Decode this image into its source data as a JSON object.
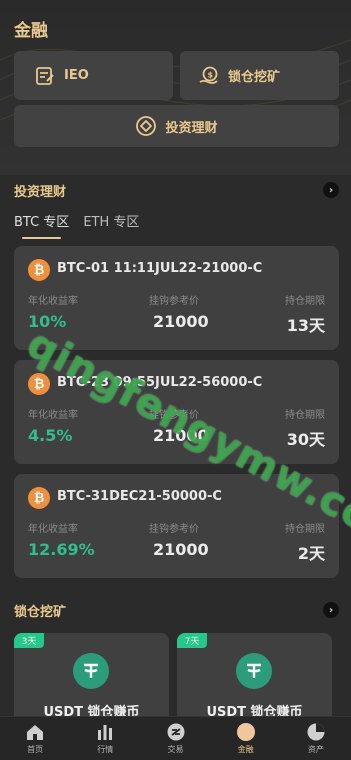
{
  "page_title": "金融",
  "tiles": {
    "ieo": "IEO",
    "mining": "锁仓挖矿",
    "invest": "投资理财"
  },
  "invest_section": {
    "title": "投资理财",
    "tabs": [
      "BTC 专区",
      "ETH 专区"
    ]
  },
  "products": [
    {
      "name": "BTC-01 11:11JUL22-21000-C",
      "rate_label": "年化收益率",
      "rate": "10%",
      "price_label": "挂钩参考价",
      "price": "21000",
      "term_label": "持仓期限",
      "term": "13天"
    },
    {
      "name": "BTC-23 09:55JUL22-56000-C",
      "rate_label": "年化收益率",
      "rate": "4.5%",
      "price_label": "挂钩参考价",
      "price": "21000",
      "term_label": "持仓期限",
      "term": "30天"
    },
    {
      "name": "BTC-31DEC21-50000-C",
      "rate_label": "年化收益率",
      "rate": "12.69%",
      "price_label": "挂钩参考价",
      "price": "21000",
      "term_label": "持仓期限",
      "term": "2天"
    }
  ],
  "mining_section": {
    "title": "锁仓挖矿",
    "items": [
      {
        "badge": "3天",
        "title": "USDT 锁仓赚币"
      },
      {
        "badge": "7天",
        "title": "USDT 锁仓赚币"
      }
    ]
  },
  "tabbar": [
    "首页",
    "行情",
    "交易",
    "金融",
    "资产"
  ],
  "watermark": "qingfengymw.com",
  "colors": {
    "accent": "#e9c98d",
    "green": "#2fbf8f",
    "btc": "#f28f3b",
    "usdt": "#2a9d7b"
  }
}
